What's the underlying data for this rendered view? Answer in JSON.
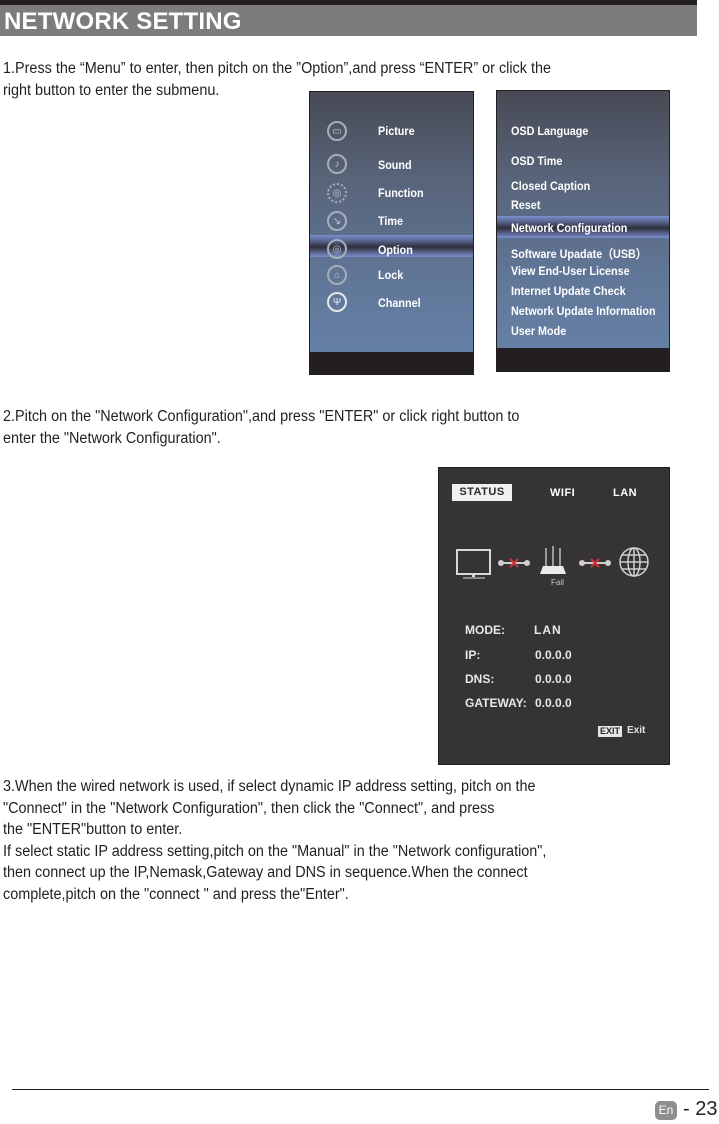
{
  "header": {
    "title": "NETWORK SETTING"
  },
  "steps": {
    "step1": [
      "1.Press the “Menu” to enter, then pitch on the ”Option”,and press “ENTER” or click the",
      "right button to enter the submenu."
    ],
    "step2": [
      "2.Pitch on the \"Network Configuration\",and press \"ENTER\" or click right button to",
      "enter the \"Network Configuration\"."
    ],
    "step3": [
      "3.When the wired network is used, if select dynamic IP address setting, pitch on the",
      "\"Connect\" in the \"Network Configuration\", then  click the \"Connect\", and press",
      "the \"ENTER\"button to enter.",
      "If select static IP address setting,pitch on the \"Manual\" in the \"Network configuration\",",
      "then connect up the IP,Nemask,Gateway and DNS in sequence.When the connect",
      "complete,pitch on the \"connect \" and press the\"Enter\"."
    ]
  },
  "main_menu": {
    "selected": "Option",
    "items": [
      {
        "label": "Picture",
        "icon": "picture-icon"
      },
      {
        "label": "Sound",
        "icon": "sound-icon"
      },
      {
        "label": "Function",
        "icon": "function-gear-icon"
      },
      {
        "label": "Time",
        "icon": "time-clock-icon"
      },
      {
        "label": "Option",
        "icon": "option-icon"
      },
      {
        "label": "Lock",
        "icon": "lock-icon"
      },
      {
        "label": "Channel",
        "icon": "channel-antenna-icon"
      }
    ]
  },
  "option_menu": {
    "selected": "Network Configuration",
    "items": [
      "OSD Language",
      "OSD Time",
      "Closed Caption",
      "Reset",
      "Network Configuration",
      "Software Upadate（USB）",
      "View End-User License",
      "Internet Update Check",
      "Network Update Information",
      "User Mode"
    ]
  },
  "network_status": {
    "tabs": [
      "STATUS",
      "WIFI",
      "LAN"
    ],
    "active_tab": "STATUS",
    "diagram": {
      "tv": "tv-icon",
      "router": "router-icon",
      "internet": "globe-icon",
      "router_status": "Fail",
      "link1": "disconnected",
      "link2": "disconnected"
    },
    "fields": [
      {
        "label": "MODE:",
        "value": "LAN"
      },
      {
        "label": "IP:",
        "value": "0.0.0.0"
      },
      {
        "label": "DNS:",
        "value": "0.0.0.0"
      },
      {
        "label": "GATEWAY:",
        "value": "0.0.0.0"
      }
    ],
    "exit_key": "EXIT",
    "exit_label": "Exit"
  },
  "footer": {
    "lang": "En",
    "page": "- 23"
  },
  "colors": {
    "title_bar": "#7d7b7c",
    "menu_highlight": "#7a8fd0",
    "fail_x": "#d0343a",
    "panel_dark": "#353334"
  }
}
